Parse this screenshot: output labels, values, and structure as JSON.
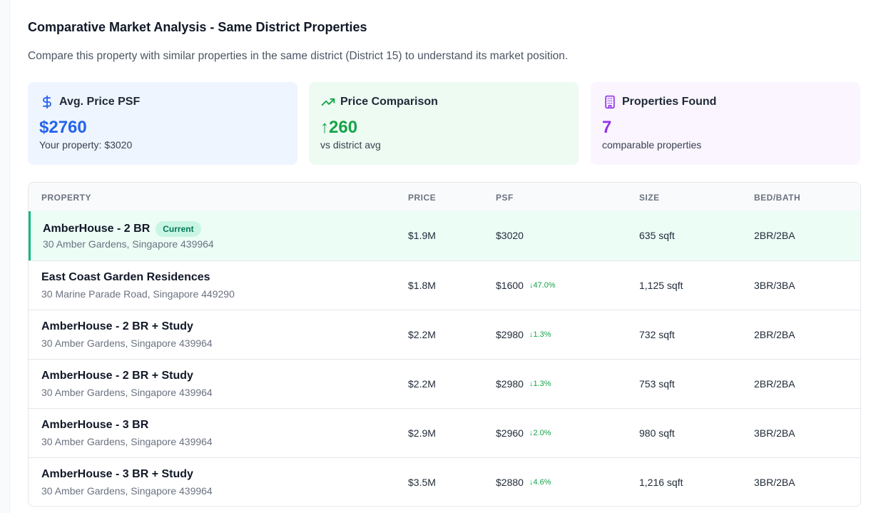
{
  "header": {
    "title": "Comparative Market Analysis - Same District Properties",
    "description": "Compare this property with similar properties in the same district (District 15) to understand its market position."
  },
  "cards": [
    {
      "icon": "dollar-icon",
      "label": "Avg. Price PSF",
      "value": "$2760",
      "sub": "Your property: $3020",
      "color": "#2563eb"
    },
    {
      "icon": "trending-up-icon",
      "label": "Price Comparison",
      "value": "↑260",
      "sub": "vs district avg",
      "color": "#16a34a"
    },
    {
      "icon": "building-icon",
      "label": "Properties Found",
      "value": "7",
      "sub": "comparable properties",
      "color": "#9333ea"
    }
  ],
  "table": {
    "headers": [
      "PROPERTY",
      "PRICE",
      "PSF",
      "SIZE",
      "BED/BATH"
    ],
    "rows": [
      {
        "name": "AmberHouse - 2 BR",
        "badge": "Current",
        "address": "30 Amber Gardens, Singapore 439964",
        "price": "$1.9M",
        "psf": "$3020",
        "delta": "",
        "size": "635 sqft",
        "bedbath": "2BR/2BA"
      },
      {
        "name": "East Coast Garden Residences",
        "badge": "",
        "address": "30 Marine Parade Road, Singapore 449290",
        "price": "$1.8M",
        "psf": "$1600",
        "delta": "↓47.0%",
        "size": "1,125 sqft",
        "bedbath": "3BR/3BA"
      },
      {
        "name": "AmberHouse - 2 BR + Study",
        "badge": "",
        "address": "30 Amber Gardens, Singapore 439964",
        "price": "$2.2M",
        "psf": "$2980",
        "delta": "↓1.3%",
        "size": "732 sqft",
        "bedbath": "2BR/2BA"
      },
      {
        "name": "AmberHouse - 2 BR + Study",
        "badge": "",
        "address": "30 Amber Gardens, Singapore 439964",
        "price": "$2.2M",
        "psf": "$2980",
        "delta": "↓1.3%",
        "size": "753 sqft",
        "bedbath": "2BR/2BA"
      },
      {
        "name": "AmberHouse - 3 BR",
        "badge": "",
        "address": "30 Amber Gardens, Singapore 439964",
        "price": "$2.9M",
        "psf": "$2960",
        "delta": "↓2.0%",
        "size": "980 sqft",
        "bedbath": "3BR/2BA"
      },
      {
        "name": "AmberHouse - 3 BR + Study",
        "badge": "",
        "address": "30 Amber Gardens, Singapore 439964",
        "price": "$3.5M",
        "psf": "$2880",
        "delta": "↓4.6%",
        "size": "1,216 sqft",
        "bedbath": "3BR/2BA"
      }
    ]
  }
}
